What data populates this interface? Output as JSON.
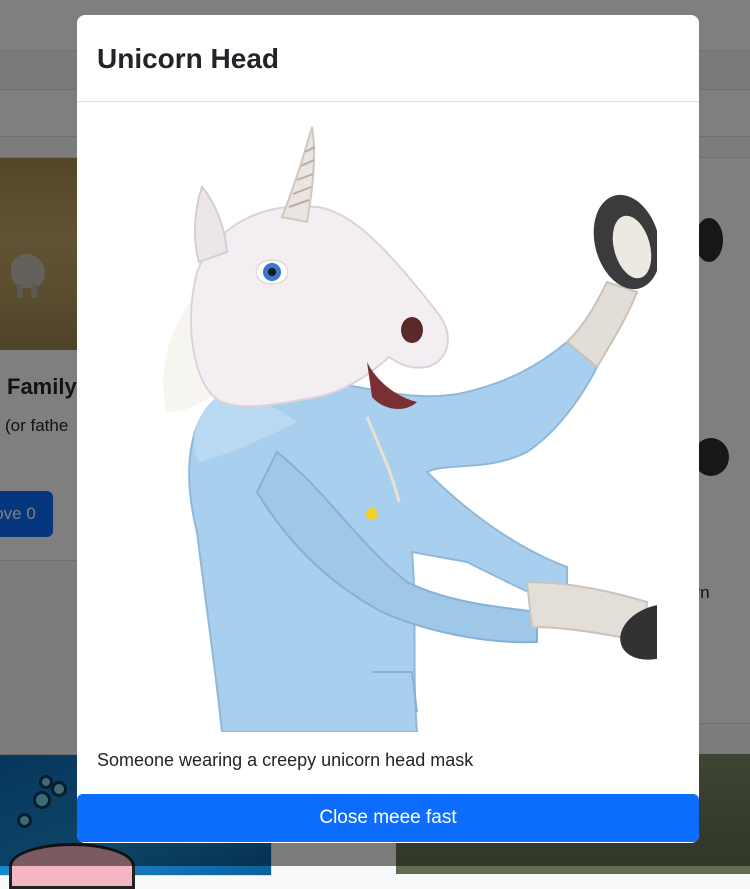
{
  "background": {
    "left_card": {
      "title": "Family",
      "text": "(or fathe",
      "button_label": "ove 0"
    },
    "right_card": {
      "text": "orn"
    }
  },
  "modal": {
    "title": "Unicorn Head",
    "caption": "Someone wearing a creepy unicorn head mask",
    "close_label": "Close meee fast"
  },
  "colors": {
    "primary": "#0d6efd",
    "hoodie": "#a9cfee",
    "mask": "#f3eef2"
  }
}
